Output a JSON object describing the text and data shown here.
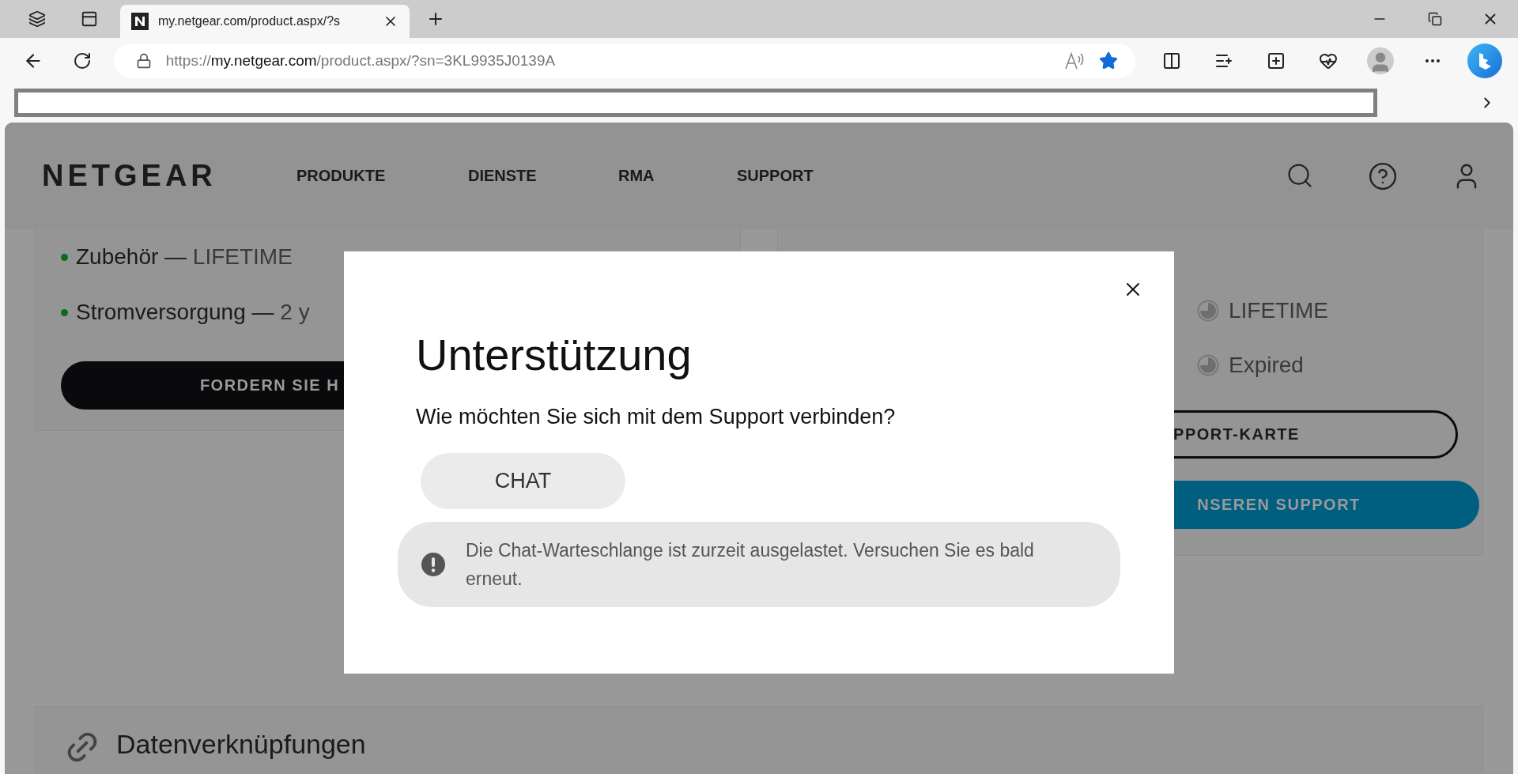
{
  "browser": {
    "tab_title": "my.netgear.com/product.aspx/?s",
    "url_scheme": "https://",
    "url_host": "my.netgear.com",
    "url_path": "/product.aspx/?sn=3KL9935J0139A",
    "favorite": true
  },
  "header": {
    "logo": "NETGEAR",
    "nav": [
      "PRODUKTE",
      "DIENSTE",
      "RMA",
      "SUPPORT"
    ]
  },
  "left_card": {
    "items": [
      {
        "label": "Zubehör —",
        "value": "LIFETIME"
      },
      {
        "label": "Stromversorgung —",
        "value": "2 y"
      }
    ],
    "button": "FORDERN SIE H"
  },
  "right_card": {
    "statuses": [
      "LIFETIME",
      "Expired"
    ],
    "outline_button": "PPORT-KARTE",
    "primary_button": "NSEREN SUPPORT"
  },
  "links_section": {
    "title": "Datenverknüpfungen"
  },
  "modal": {
    "title": "Unterstützung",
    "question": "Wie möchten Sie sich mit dem Support verbinden?",
    "chat_button": "CHAT",
    "alert": "Die Chat-Warteschlange ist zurzeit ausgelastet. Versuchen Sie es bald erneut."
  }
}
